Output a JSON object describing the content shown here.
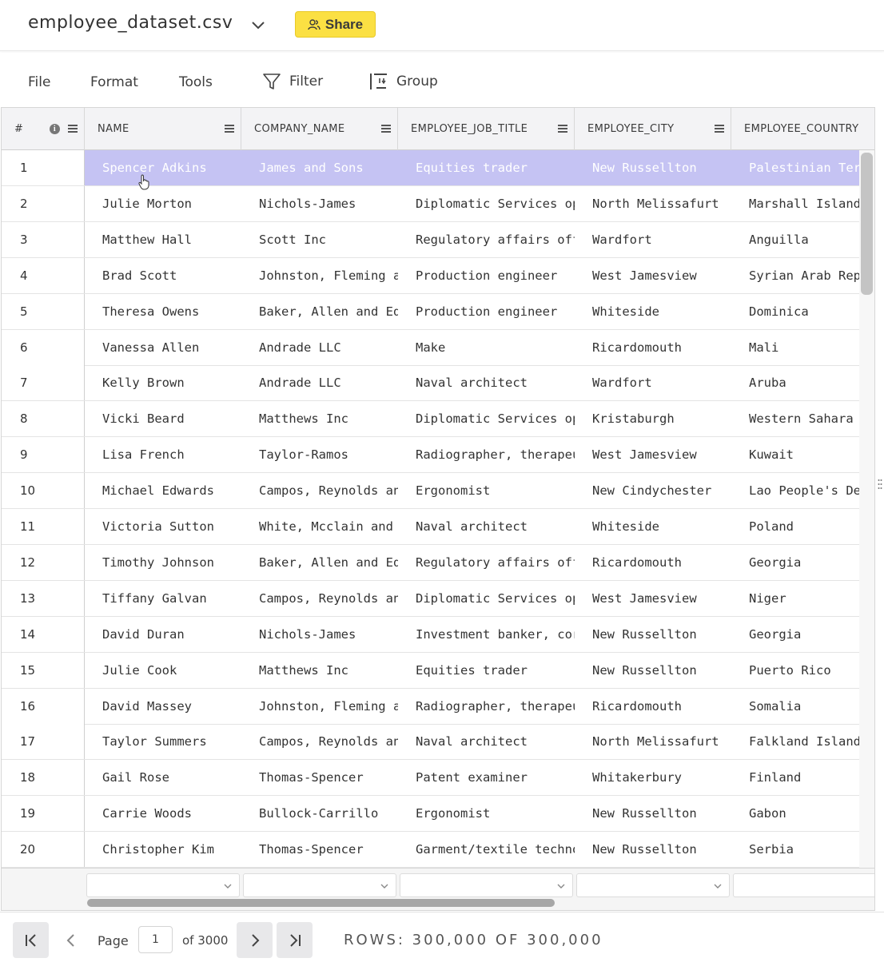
{
  "header": {
    "file_title": "employee_dataset.csv",
    "share_label": "Share"
  },
  "toolbar": {
    "file_label": "File",
    "format_label": "Format",
    "tools_label": "Tools",
    "filter_label": "Filter",
    "group_label": "Group"
  },
  "grid": {
    "index_header": "#",
    "columns": [
      "NAME",
      "COMPANY_NAME",
      "EMPLOYEE_JOB_TITLE",
      "EMPLOYEE_CITY",
      "EMPLOYEE_COUNTRY"
    ],
    "selected_row": 1,
    "rows": [
      [
        "1",
        "Spencer Adkins",
        "James and Sons",
        "Equities trader",
        "New Russellton",
        "Palestinian Ter"
      ],
      [
        "2",
        "Julie Morton",
        "Nichols-James",
        "Diplomatic Services op",
        "North Melissafurt",
        "Marshall Island"
      ],
      [
        "3",
        "Matthew Hall",
        "Scott Inc",
        "Regulatory affairs off",
        "Wardfort",
        "Anguilla"
      ],
      [
        "4",
        "Brad Scott",
        "Johnston, Fleming a",
        "Production engineer",
        "West Jamesview",
        "Syrian Arab Rep"
      ],
      [
        "5",
        "Theresa Owens",
        "Baker, Allen and Ed",
        "Production engineer",
        "Whiteside",
        "Dominica"
      ],
      [
        "6",
        "Vanessa Allen",
        "Andrade LLC",
        "Make",
        "Ricardomouth",
        "Mali"
      ],
      [
        "7",
        "Kelly Brown",
        "Andrade LLC",
        "Naval architect",
        "Wardfort",
        "Aruba"
      ],
      [
        "8",
        "Vicki Beard",
        "Matthews Inc",
        "Diplomatic Services op",
        "Kristaburgh",
        "Western Sahara"
      ],
      [
        "9",
        "Lisa French",
        "Taylor-Ramos",
        "Radiographer, therapeu",
        "West Jamesview",
        "Kuwait"
      ],
      [
        "10",
        "Michael Edwards",
        "Campos, Reynolds an",
        "Ergonomist",
        "New Cindychester",
        "Lao People's De"
      ],
      [
        "11",
        "Victoria Sutton",
        "White, Mcclain and",
        "Naval architect",
        "Whiteside",
        "Poland"
      ],
      [
        "12",
        "Timothy Johnson",
        "Baker, Allen and Ed",
        "Regulatory affairs off",
        "Ricardomouth",
        "Georgia"
      ],
      [
        "13",
        "Tiffany Galvan",
        "Campos, Reynolds an",
        "Diplomatic Services op",
        "West Jamesview",
        "Niger"
      ],
      [
        "14",
        "David Duran",
        "Nichols-James",
        "Investment banker, cor",
        "New Russellton",
        "Georgia"
      ],
      [
        "15",
        "Julie Cook",
        "Matthews Inc",
        "Equities trader",
        "New Russellton",
        "Puerto Rico"
      ],
      [
        "16",
        "David Massey",
        "Johnston, Fleming a",
        "Radiographer, therapeu",
        "Ricardomouth",
        "Somalia"
      ],
      [
        "17",
        "Taylor Summers",
        "Campos, Reynolds an",
        "Naval architect",
        "North Melissafurt",
        "Falkland Island"
      ],
      [
        "18",
        "Gail Rose",
        "Thomas-Spencer",
        "Patent examiner",
        "Whitakerbury",
        "Finland"
      ],
      [
        "19",
        "Carrie Woods",
        "Bullock-Carrillo",
        "Ergonomist",
        "New Russellton",
        "Gabon"
      ],
      [
        "20",
        "Christopher Kim",
        "Thomas-Spencer",
        "Garment/textile techno",
        "New Russellton",
        "Serbia"
      ]
    ]
  },
  "pager": {
    "page_label": "Page",
    "current_page": "1",
    "of_label": "of 3000",
    "rows_label": "ROWS: 300,000 OF 300,000"
  }
}
